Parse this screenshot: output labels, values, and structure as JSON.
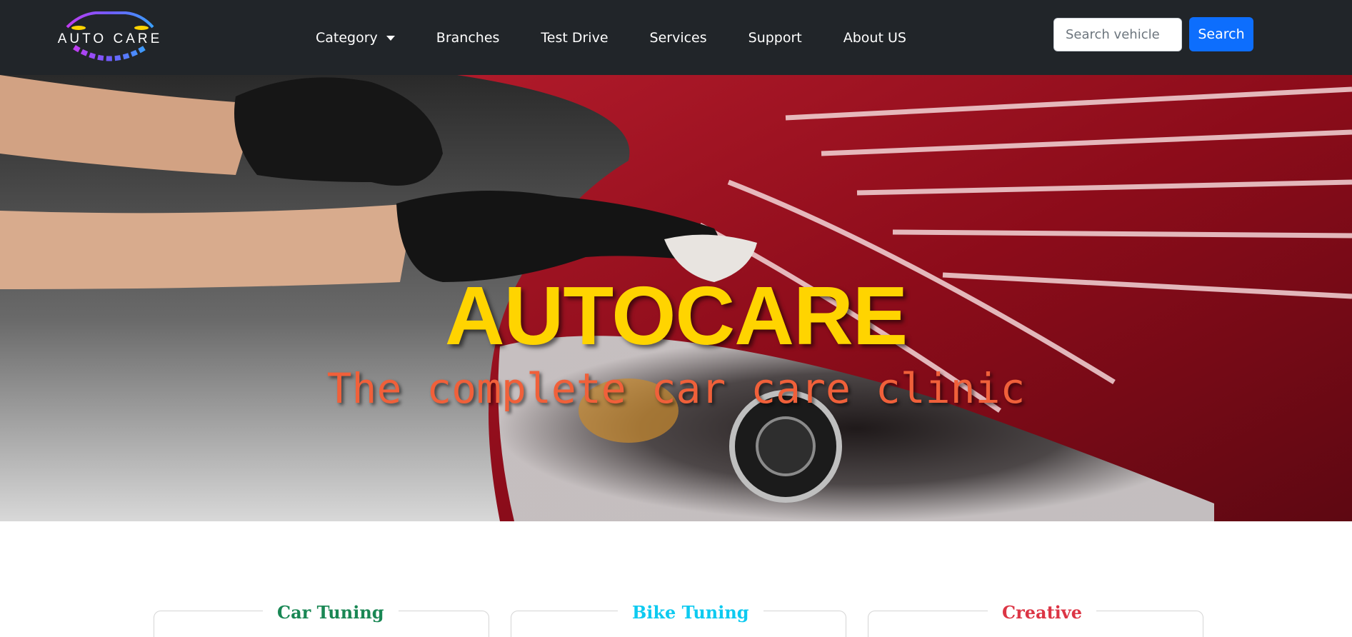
{
  "brand": {
    "logo_text": "AUTO CARE"
  },
  "nav": {
    "items": [
      {
        "label": "Category",
        "dropdown": true
      },
      {
        "label": "Branches"
      },
      {
        "label": "Test Drive"
      },
      {
        "label": "Services"
      },
      {
        "label": "Support"
      },
      {
        "label": "About US"
      }
    ]
  },
  "search": {
    "placeholder": "Search vehicle",
    "value": "",
    "button_label": "Search"
  },
  "hero": {
    "title": "AUTOCARE",
    "subtitle": "The complete car care clinic"
  },
  "cards": [
    {
      "title": "Car Tuning",
      "color": "#198754"
    },
    {
      "title": "Bike Tuning",
      "color": "#0dcaf0"
    },
    {
      "title": "Creative",
      "color": "#dc3545"
    }
  ],
  "colors": {
    "navbar_bg": "#212529",
    "accent_blue": "#0d6efd",
    "hero_title": "#ffd400",
    "hero_subtitle": "#f0603a"
  }
}
